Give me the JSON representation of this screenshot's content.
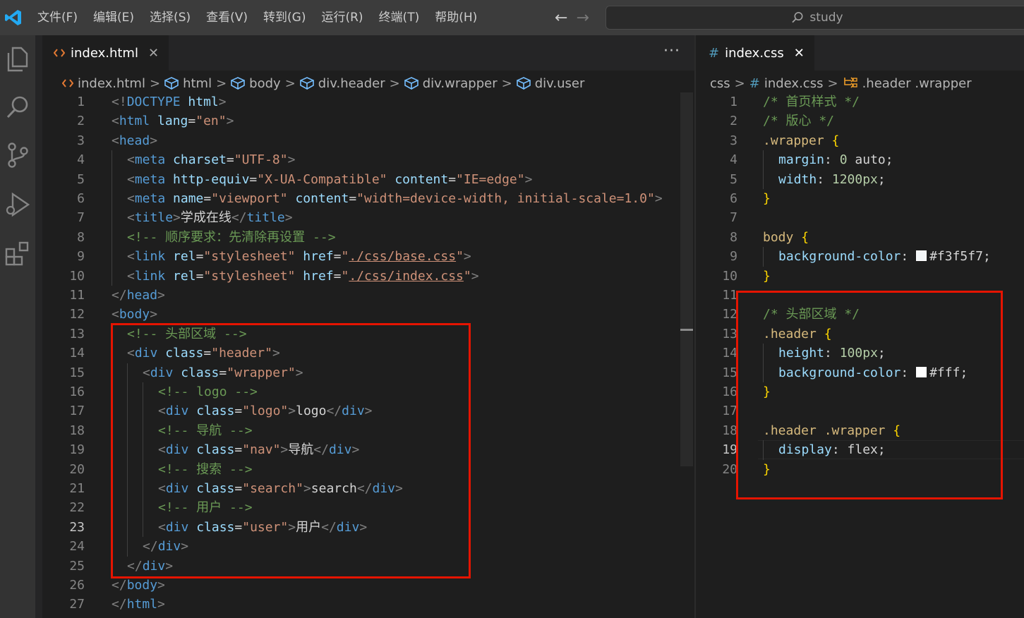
{
  "titlebar": {
    "menu": [
      "文件(F)",
      "编辑(E)",
      "选择(S)",
      "查看(V)",
      "转到(G)",
      "运行(R)",
      "终端(T)",
      "帮助(H)"
    ],
    "back_arrow": "←",
    "forward_arrow": "→",
    "search_text": "study"
  },
  "activity_icons": [
    "explorer-icon",
    "search-icon",
    "source-control-icon",
    "run-debug-icon",
    "extensions-icon"
  ],
  "left_editor": {
    "tab": {
      "label": "index.html",
      "close": "✕"
    },
    "more": "···",
    "breadcrumb": [
      "index.html",
      "html",
      "body",
      "div.header",
      "div.wrapper",
      "div.user"
    ],
    "breadcrumb_sep": ">",
    "current_line": 23,
    "lines": [
      {
        "n": "1",
        "indent": 0,
        "tokens": [
          [
            "<!",
            "punct"
          ],
          [
            "DOCTYPE",
            "tag"
          ],
          [
            " ",
            "txt"
          ],
          [
            "html",
            "attr"
          ],
          [
            ">",
            "punct"
          ]
        ]
      },
      {
        "n": "2",
        "indent": 0,
        "tokens": [
          [
            "<",
            "punct"
          ],
          [
            "html",
            "tag"
          ],
          [
            " ",
            "txt"
          ],
          [
            "lang",
            "attr"
          ],
          [
            "=",
            "txt"
          ],
          [
            "\"en\"",
            "str"
          ],
          [
            ">",
            "punct"
          ]
        ]
      },
      {
        "n": "3",
        "indent": 0,
        "tokens": [
          [
            "<",
            "punct"
          ],
          [
            "head",
            "tag"
          ],
          [
            ">",
            "punct"
          ]
        ]
      },
      {
        "n": "4",
        "indent": 1,
        "tokens": [
          [
            "<",
            "punct"
          ],
          [
            "meta",
            "tag"
          ],
          [
            " ",
            "txt"
          ],
          [
            "charset",
            "attr"
          ],
          [
            "=",
            "txt"
          ],
          [
            "\"UTF-8\"",
            "str"
          ],
          [
            ">",
            "punct"
          ]
        ]
      },
      {
        "n": "5",
        "indent": 1,
        "tokens": [
          [
            "<",
            "punct"
          ],
          [
            "meta",
            "tag"
          ],
          [
            " ",
            "txt"
          ],
          [
            "http-equiv",
            "attr"
          ],
          [
            "=",
            "txt"
          ],
          [
            "\"X-UA-Compatible\"",
            "str"
          ],
          [
            " ",
            "txt"
          ],
          [
            "content",
            "attr"
          ],
          [
            "=",
            "txt"
          ],
          [
            "\"IE=edge\"",
            "str"
          ],
          [
            ">",
            "punct"
          ]
        ]
      },
      {
        "n": "6",
        "indent": 1,
        "tokens": [
          [
            "<",
            "punct"
          ],
          [
            "meta",
            "tag"
          ],
          [
            " ",
            "txt"
          ],
          [
            "name",
            "attr"
          ],
          [
            "=",
            "txt"
          ],
          [
            "\"viewport\"",
            "str"
          ],
          [
            " ",
            "txt"
          ],
          [
            "content",
            "attr"
          ],
          [
            "=",
            "txt"
          ],
          [
            "\"width=device-width, initial-scale=1.0\"",
            "str"
          ],
          [
            ">",
            "punct"
          ]
        ]
      },
      {
        "n": "7",
        "indent": 1,
        "tokens": [
          [
            "<",
            "punct"
          ],
          [
            "title",
            "tag"
          ],
          [
            ">",
            "punct"
          ],
          [
            "学成在线",
            "txt"
          ],
          [
            "</",
            "punct"
          ],
          [
            "title",
            "tag"
          ],
          [
            ">",
            "punct"
          ]
        ]
      },
      {
        "n": "8",
        "indent": 1,
        "tokens": [
          [
            "<!-- 顺序要求：先清除再设置 -->",
            "com"
          ]
        ]
      },
      {
        "n": "9",
        "indent": 1,
        "tokens": [
          [
            "<",
            "punct"
          ],
          [
            "link",
            "tag"
          ],
          [
            " ",
            "txt"
          ],
          [
            "rel",
            "attr"
          ],
          [
            "=",
            "txt"
          ],
          [
            "\"stylesheet\"",
            "str"
          ],
          [
            " ",
            "txt"
          ],
          [
            "href",
            "attr"
          ],
          [
            "=",
            "txt"
          ],
          [
            "\"",
            "str"
          ],
          [
            "./css/base.css",
            "strlink"
          ],
          [
            "\"",
            "str"
          ],
          [
            ">",
            "punct"
          ]
        ]
      },
      {
        "n": "10",
        "indent": 1,
        "tokens": [
          [
            "<",
            "punct"
          ],
          [
            "link",
            "tag"
          ],
          [
            " ",
            "txt"
          ],
          [
            "rel",
            "attr"
          ],
          [
            "=",
            "txt"
          ],
          [
            "\"stylesheet\"",
            "str"
          ],
          [
            " ",
            "txt"
          ],
          [
            "href",
            "attr"
          ],
          [
            "=",
            "txt"
          ],
          [
            "\"",
            "str"
          ],
          [
            "./css/index.css",
            "strlink"
          ],
          [
            "\"",
            "str"
          ],
          [
            ">",
            "punct"
          ]
        ]
      },
      {
        "n": "11",
        "indent": 0,
        "tokens": [
          [
            "</",
            "punct"
          ],
          [
            "head",
            "tag"
          ],
          [
            ">",
            "punct"
          ]
        ]
      },
      {
        "n": "12",
        "indent": 0,
        "tokens": [
          [
            "<",
            "punct"
          ],
          [
            "body",
            "tag"
          ],
          [
            ">",
            "punct"
          ]
        ]
      },
      {
        "n": "13",
        "indent": 1,
        "tokens": [
          [
            "<!-- 头部区域 -->",
            "com"
          ]
        ]
      },
      {
        "n": "14",
        "indent": 1,
        "tokens": [
          [
            "<",
            "punct"
          ],
          [
            "div",
            "tag"
          ],
          [
            " ",
            "txt"
          ],
          [
            "class",
            "attr"
          ],
          [
            "=",
            "txt"
          ],
          [
            "\"header\"",
            "str"
          ],
          [
            ">",
            "punct"
          ]
        ]
      },
      {
        "n": "15",
        "indent": 2,
        "tokens": [
          [
            "<",
            "punct"
          ],
          [
            "div",
            "tag"
          ],
          [
            " ",
            "txt"
          ],
          [
            "class",
            "attr"
          ],
          [
            "=",
            "txt"
          ],
          [
            "\"wrapper\"",
            "str"
          ],
          [
            ">",
            "punct"
          ]
        ]
      },
      {
        "n": "16",
        "indent": 3,
        "tokens": [
          [
            "<!-- logo -->",
            "com"
          ]
        ]
      },
      {
        "n": "17",
        "indent": 3,
        "tokens": [
          [
            "<",
            "punct"
          ],
          [
            "div",
            "tag"
          ],
          [
            " ",
            "txt"
          ],
          [
            "class",
            "attr"
          ],
          [
            "=",
            "txt"
          ],
          [
            "\"logo\"",
            "str"
          ],
          [
            ">",
            "punct"
          ],
          [
            "logo",
            "txt"
          ],
          [
            "</",
            "punct"
          ],
          [
            "div",
            "tag"
          ],
          [
            ">",
            "punct"
          ]
        ]
      },
      {
        "n": "18",
        "indent": 3,
        "tokens": [
          [
            "<!-- 导航 -->",
            "com"
          ]
        ]
      },
      {
        "n": "19",
        "indent": 3,
        "tokens": [
          [
            "<",
            "punct"
          ],
          [
            "div",
            "tag"
          ],
          [
            " ",
            "txt"
          ],
          [
            "class",
            "attr"
          ],
          [
            "=",
            "txt"
          ],
          [
            "\"nav\"",
            "str"
          ],
          [
            ">",
            "punct"
          ],
          [
            "导航",
            "txt"
          ],
          [
            "</",
            "punct"
          ],
          [
            "div",
            "tag"
          ],
          [
            ">",
            "punct"
          ]
        ]
      },
      {
        "n": "20",
        "indent": 3,
        "tokens": [
          [
            "<!-- 搜索 -->",
            "com"
          ]
        ]
      },
      {
        "n": "21",
        "indent": 3,
        "tokens": [
          [
            "<",
            "punct"
          ],
          [
            "div",
            "tag"
          ],
          [
            " ",
            "txt"
          ],
          [
            "class",
            "attr"
          ],
          [
            "=",
            "txt"
          ],
          [
            "\"search\"",
            "str"
          ],
          [
            ">",
            "punct"
          ],
          [
            "search",
            "txt"
          ],
          [
            "</",
            "punct"
          ],
          [
            "div",
            "tag"
          ],
          [
            ">",
            "punct"
          ]
        ]
      },
      {
        "n": "22",
        "indent": 3,
        "tokens": [
          [
            "<!-- 用户 -->",
            "com"
          ]
        ]
      },
      {
        "n": "23",
        "indent": 3,
        "tokens": [
          [
            "<",
            "punct"
          ],
          [
            "div",
            "tag"
          ],
          [
            " ",
            "txt"
          ],
          [
            "class",
            "attr"
          ],
          [
            "=",
            "txt"
          ],
          [
            "\"user\"",
            "str"
          ],
          [
            ">",
            "punct"
          ],
          [
            "用户",
            "txt"
          ],
          [
            "</",
            "punct"
          ],
          [
            "div",
            "tag"
          ],
          [
            ">",
            "punct"
          ]
        ]
      },
      {
        "n": "24",
        "indent": 2,
        "tokens": [
          [
            "</",
            "punct"
          ],
          [
            "div",
            "tag"
          ],
          [
            ">",
            "punct"
          ]
        ]
      },
      {
        "n": "25",
        "indent": 1,
        "tokens": [
          [
            "</",
            "punct"
          ],
          [
            "div",
            "tag"
          ],
          [
            ">",
            "punct"
          ]
        ]
      },
      {
        "n": "26",
        "indent": 0,
        "tokens": [
          [
            "</",
            "punct"
          ],
          [
            "body",
            "tag"
          ],
          [
            ">",
            "punct"
          ]
        ]
      },
      {
        "n": "27",
        "indent": 0,
        "tokens": [
          [
            "</",
            "punct"
          ],
          [
            "html",
            "tag"
          ],
          [
            ">",
            "punct"
          ]
        ]
      }
    ]
  },
  "right_editor": {
    "tab": {
      "icon": "#",
      "label": "index.css",
      "close": "✕"
    },
    "breadcrumb": [
      "css",
      "index.css",
      ".header .wrapper"
    ],
    "breadcrumb_sep": ">",
    "current_line": 19,
    "lines": [
      {
        "n": "1",
        "indent": 0,
        "tokens": [
          [
            "/* 首页样式 */",
            "com"
          ]
        ]
      },
      {
        "n": "2",
        "indent": 0,
        "tokens": [
          [
            "/* 版心 */",
            "com"
          ]
        ]
      },
      {
        "n": "3",
        "indent": 0,
        "tokens": [
          [
            ".wrapper",
            "sel"
          ],
          [
            " ",
            "txt"
          ],
          [
            "{",
            "brace"
          ]
        ]
      },
      {
        "n": "4",
        "indent": 1,
        "tokens": [
          [
            "margin",
            "prop"
          ],
          [
            ": ",
            "txt"
          ],
          [
            "0",
            "num"
          ],
          [
            " auto;",
            "val"
          ]
        ]
      },
      {
        "n": "5",
        "indent": 1,
        "tokens": [
          [
            "width",
            "prop"
          ],
          [
            ": ",
            "txt"
          ],
          [
            "1200px",
            "num"
          ],
          [
            ";",
            "val"
          ]
        ]
      },
      {
        "n": "6",
        "indent": 0,
        "tokens": [
          [
            "}",
            "brace"
          ]
        ]
      },
      {
        "n": "7",
        "indent": 0,
        "tokens": []
      },
      {
        "n": "8",
        "indent": 0,
        "tokens": [
          [
            "body",
            "sel"
          ],
          [
            " ",
            "txt"
          ],
          [
            "{",
            "brace"
          ]
        ]
      },
      {
        "n": "9",
        "indent": 1,
        "tokens": [
          [
            "background-color",
            "prop"
          ],
          [
            ": ",
            "txt"
          ],
          [
            "#f3f5f7",
            "swatch"
          ],
          [
            "#f3f5f7",
            "val"
          ],
          [
            ";",
            "val"
          ]
        ]
      },
      {
        "n": "10",
        "indent": 0,
        "tokens": [
          [
            "}",
            "brace"
          ]
        ]
      },
      {
        "n": "11",
        "indent": 0,
        "tokens": []
      },
      {
        "n": "12",
        "indent": 0,
        "tokens": [
          [
            "/* 头部区域 */",
            "com"
          ]
        ]
      },
      {
        "n": "13",
        "indent": 0,
        "tokens": [
          [
            ".header",
            "sel"
          ],
          [
            " ",
            "txt"
          ],
          [
            "{",
            "brace"
          ]
        ]
      },
      {
        "n": "14",
        "indent": 1,
        "tokens": [
          [
            "height",
            "prop"
          ],
          [
            ": ",
            "txt"
          ],
          [
            "100px",
            "num"
          ],
          [
            ";",
            "val"
          ]
        ]
      },
      {
        "n": "15",
        "indent": 1,
        "tokens": [
          [
            "background-color",
            "prop"
          ],
          [
            ": ",
            "txt"
          ],
          [
            "#fff",
            "swatch"
          ],
          [
            "#fff",
            "val"
          ],
          [
            ";",
            "val"
          ]
        ]
      },
      {
        "n": "16",
        "indent": 0,
        "tokens": [
          [
            "}",
            "brace"
          ]
        ]
      },
      {
        "n": "17",
        "indent": 0,
        "tokens": []
      },
      {
        "n": "18",
        "indent": 0,
        "tokens": [
          [
            ".header .wrapper",
            "sel"
          ],
          [
            " ",
            "txt"
          ],
          [
            "{",
            "brace"
          ]
        ]
      },
      {
        "n": "19",
        "indent": 1,
        "tokens": [
          [
            "display",
            "prop"
          ],
          [
            ": ",
            "txt"
          ],
          [
            "flex",
            "val"
          ],
          [
            ";",
            "val"
          ]
        ]
      },
      {
        "n": "20",
        "indent": 0,
        "tokens": [
          [
            "}",
            "brace"
          ]
        ]
      }
    ]
  },
  "colors": {
    "highlight_box": "#e51400",
    "accent": "#007acc"
  }
}
